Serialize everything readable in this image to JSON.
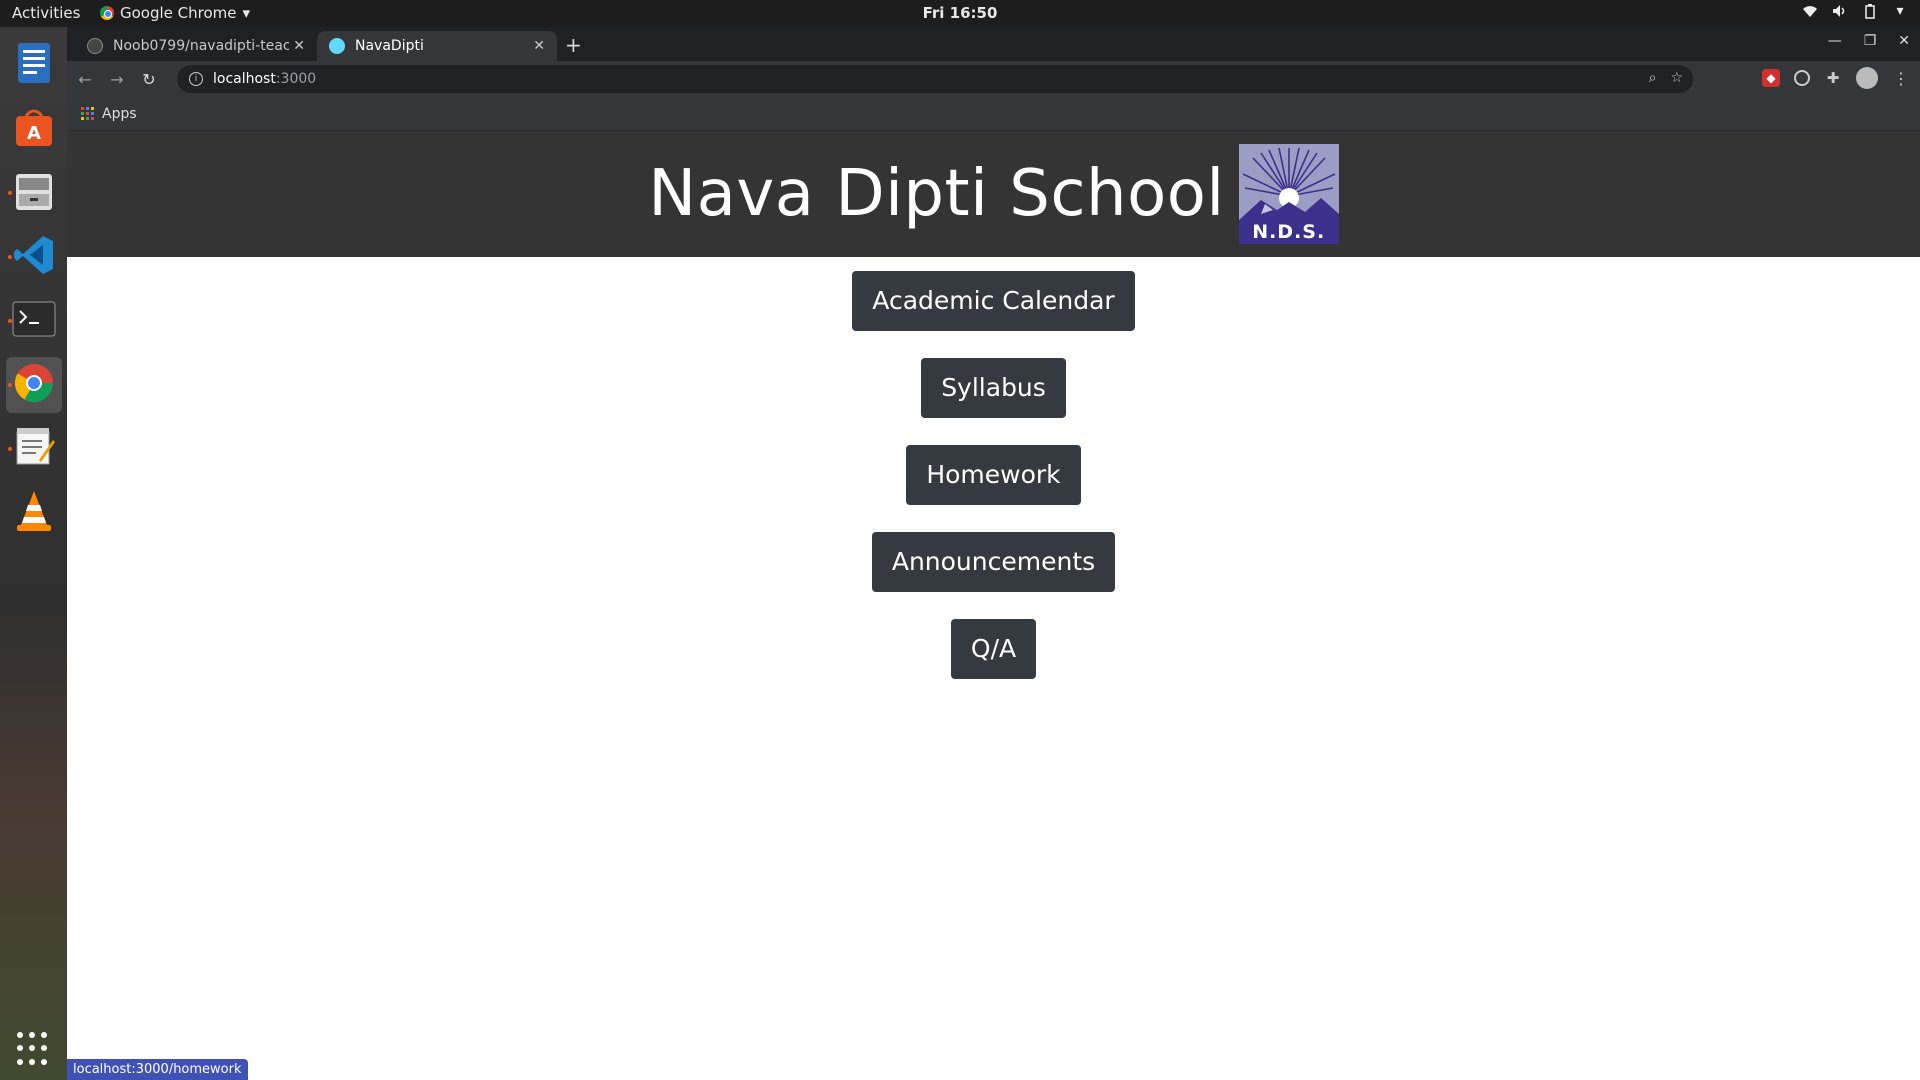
{
  "system": {
    "activities": "Activities",
    "app_name": "Google Chrome",
    "clock": "Fri 16:50"
  },
  "browser": {
    "tabs": [
      {
        "label": "Noob0799/navadipti-teac"
      },
      {
        "label": "NavaDipti"
      }
    ],
    "url_host": "localhost",
    "url_port": ":3000",
    "bookmarks_apps": "Apps",
    "status_url": "localhost:3000/homework"
  },
  "site": {
    "title": "Nava Dipti School",
    "logo_text": "N.D.S.",
    "menu": [
      {
        "label": "Academic Calendar"
      },
      {
        "label": "Syllabus"
      },
      {
        "label": "Homework"
      },
      {
        "label": "Announcements"
      },
      {
        "label": "Q/A"
      }
    ]
  },
  "colors": {
    "header_bg": "#343434",
    "button_bg": "#343a40",
    "logo_band": "#3d2f8c"
  }
}
